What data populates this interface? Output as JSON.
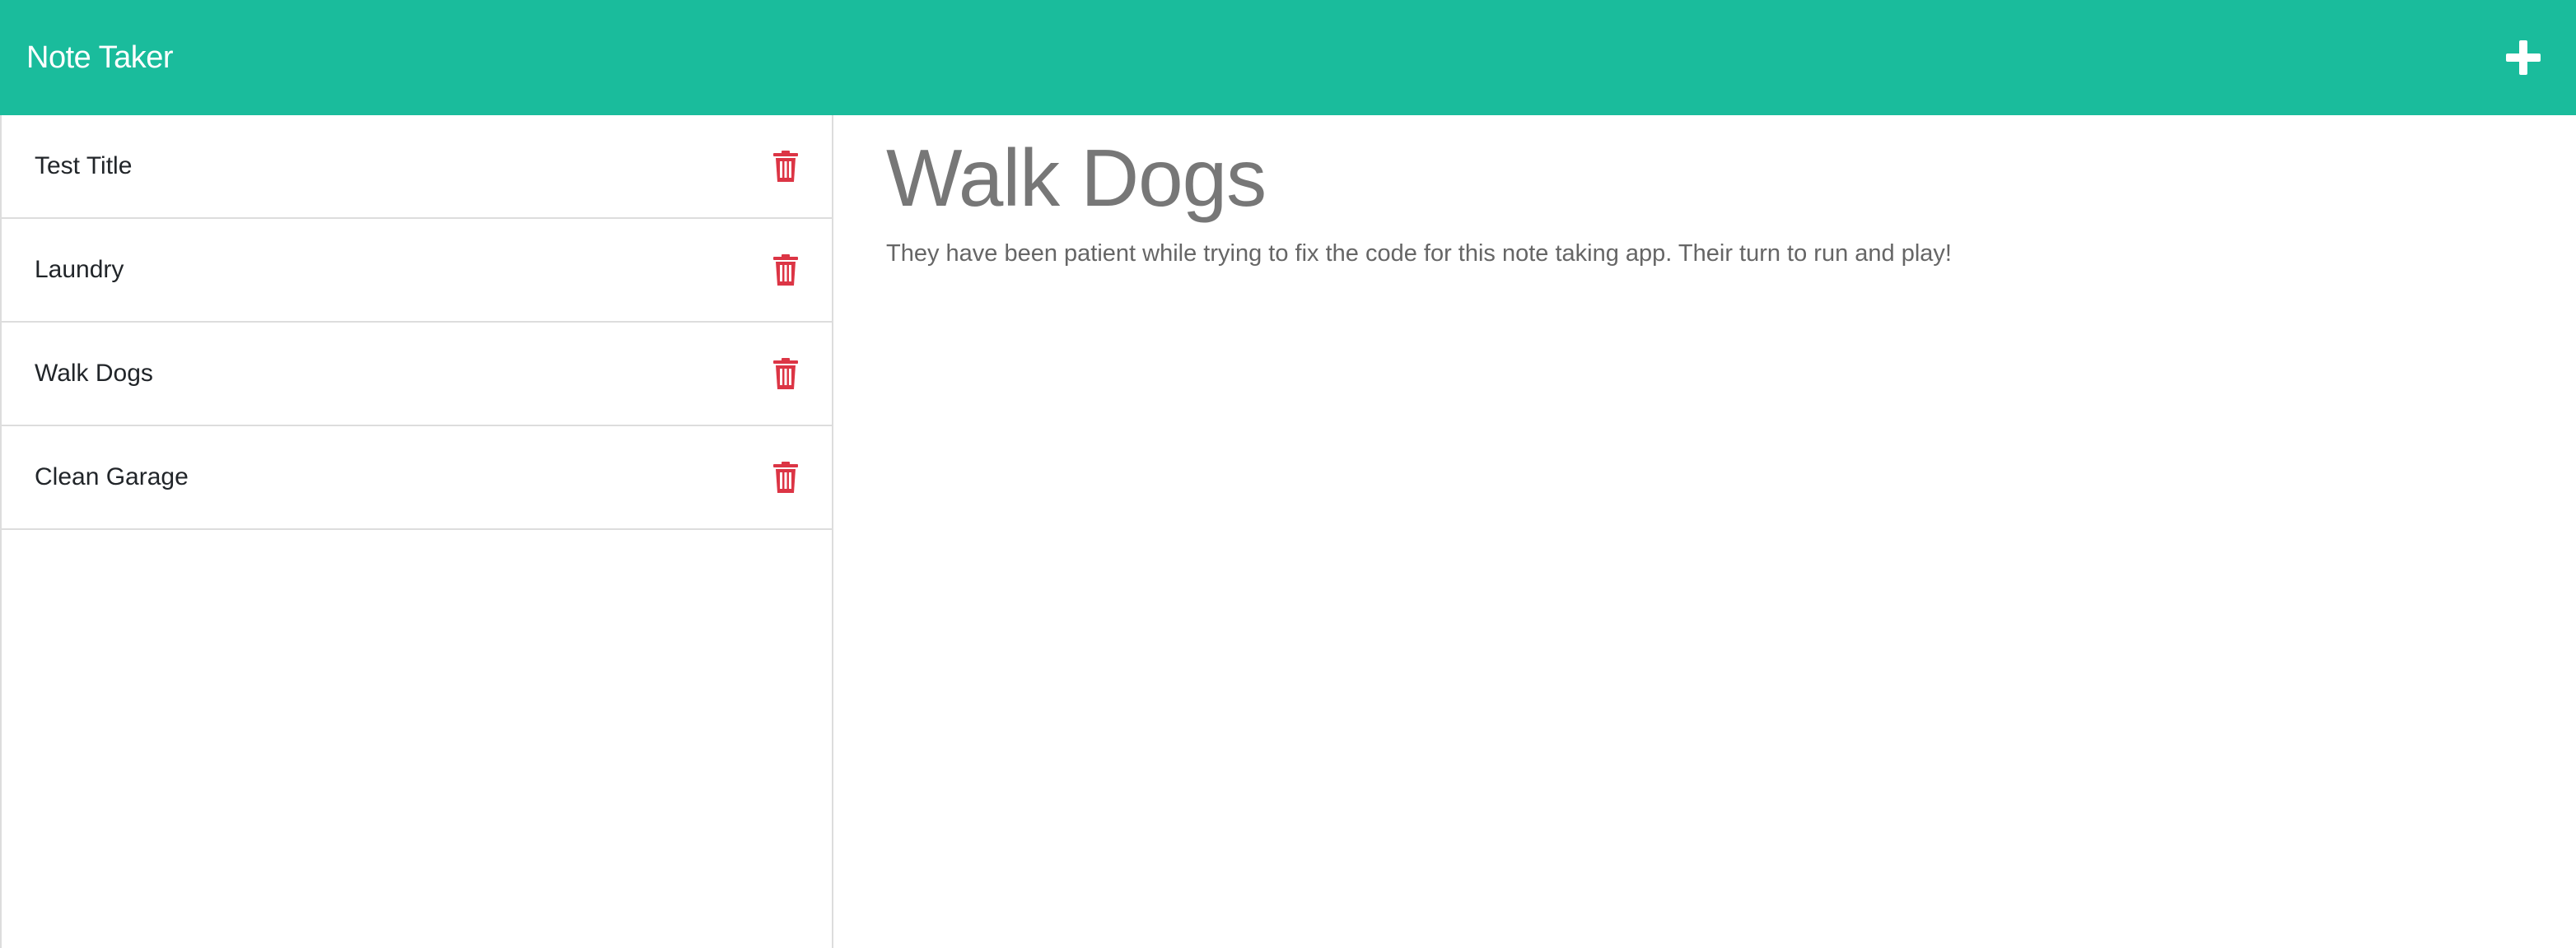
{
  "app": {
    "title": "Note Taker"
  },
  "toolbar": {
    "new_note_icon": "plus-icon"
  },
  "notes": [
    {
      "title": "Test Title"
    },
    {
      "title": "Laundry"
    },
    {
      "title": "Walk Dogs"
    },
    {
      "title": "Clean Garage"
    }
  ],
  "active_note": {
    "title": "Walk Dogs",
    "text": "They have been patient while trying to fix the code for this note taking app. Their turn to run and play!"
  },
  "colors": {
    "brand": "#1abc9c",
    "delete": "#dc3545",
    "heading": "#777777"
  }
}
